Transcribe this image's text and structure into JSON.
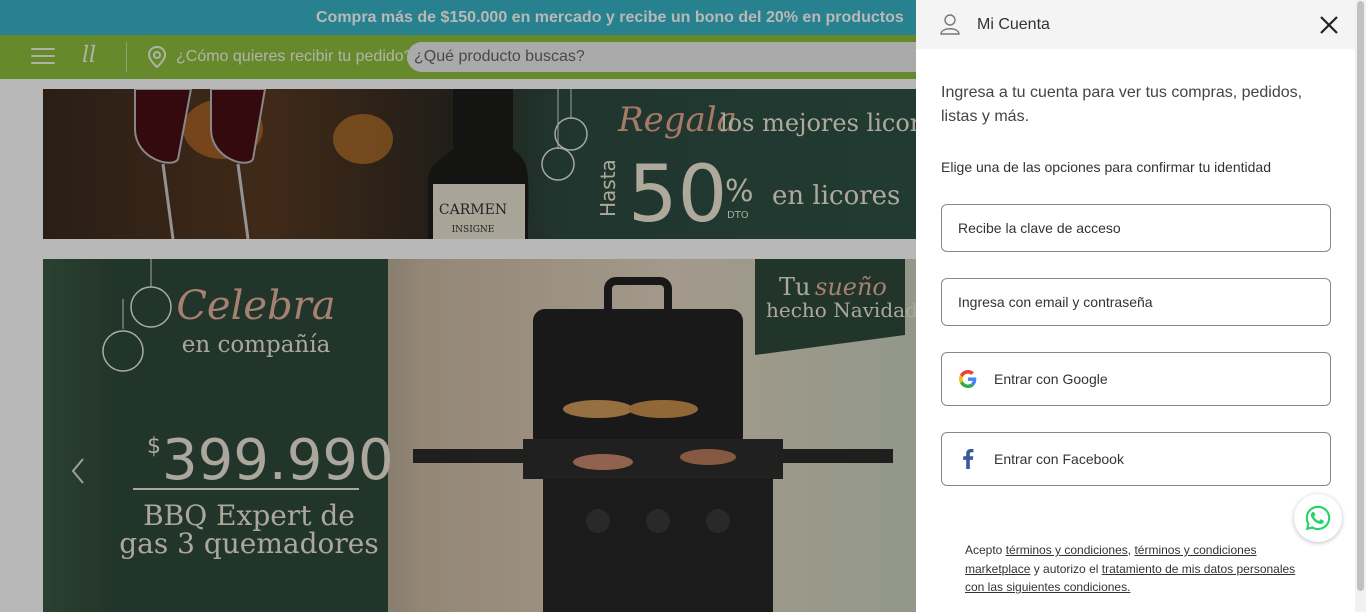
{
  "promo": {
    "text": "Compra más de $150.000 en mercado y recibe un bono del 20% en productos"
  },
  "nav": {
    "logo_text": "ll",
    "delivery_text": "¿Cómo quieres recibir tu pedido?",
    "search_placeholder": "¿Qué producto buscas?"
  },
  "banner_top": {
    "wine_label": "CARMEN",
    "wine_sublabel": "INSIGNE",
    "regala": "Regala",
    "headline": "los mejores licores",
    "hasta": "Hasta",
    "discount": "50",
    "percent": "%",
    "dto": "DTO",
    "suffix": "en licores"
  },
  "banner_main": {
    "celebra": "Celebra",
    "en_compania": "en compañía",
    "currency": "$",
    "price": "399.990",
    "product_line1": "BBQ Expert de",
    "product_line2": "gas 3 quemadores",
    "tu": "Tu",
    "sueno": "sueño",
    "hecho_navidad": "hecho Navidad"
  },
  "drawer": {
    "title": "Mi Cuenta",
    "intro": "Ingresa a tu cuenta para ver tus compras, pedidos, listas y más.",
    "subtitle": "Elige una de las opciones para confirmar tu identidad",
    "options": [
      {
        "label": "Recibe la clave de acceso"
      },
      {
        "label": "Ingresa con email y contraseña"
      },
      {
        "label": "Entrar con Google",
        "icon": "google-icon"
      },
      {
        "label": "Entrar con Facebook",
        "icon": "facebook-icon"
      }
    ],
    "legal": {
      "prefix": "Acepto ",
      "link1": "términos y condiciones",
      "sep1": ", ",
      "link2": "términos y condiciones marketplace",
      "mid": " y autorizo el ",
      "link3": "tratamiento de mis datos personales con las siguientes condiciones."
    }
  },
  "colors": {
    "promo_bar": "#38b3c7",
    "nav_bar": "#8ec03c",
    "banner_green": "#2f5447",
    "facebook_blue": "#3b5998",
    "whatsapp_green": "#25d366"
  }
}
